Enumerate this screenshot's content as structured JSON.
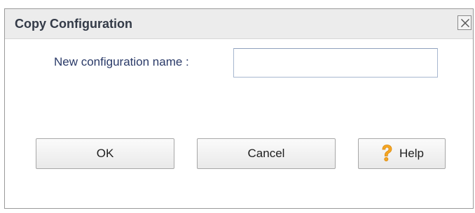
{
  "dialog": {
    "title": "Copy Configuration",
    "close_icon": "close-icon"
  },
  "form": {
    "name_label": "New configuration name :",
    "name_value": "",
    "name_placeholder": ""
  },
  "buttons": {
    "ok_label": "OK",
    "cancel_label": "Cancel",
    "help_label": "Help",
    "help_icon": "question-mark-icon"
  },
  "colors": {
    "title_text": "#333a47",
    "label_text": "#2a3a68",
    "help_icon": "#f5a623"
  }
}
